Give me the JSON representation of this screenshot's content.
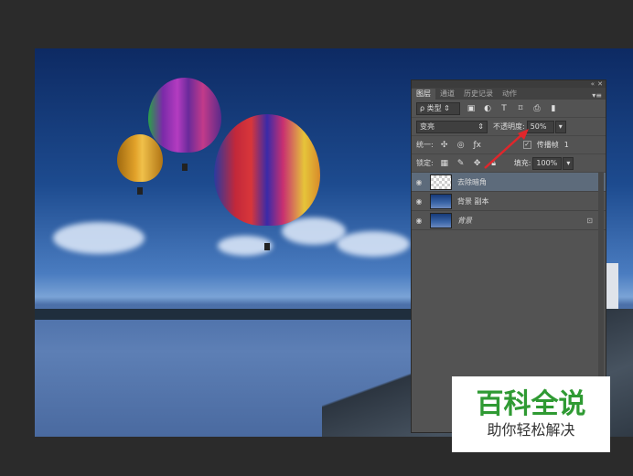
{
  "layers_panel": {
    "tabs": [
      "图层",
      "通道",
      "历史记录",
      "动作"
    ],
    "filter_kind": "类型",
    "blend_mode": "变亮",
    "opacity_label": "不透明度:",
    "opacity_value": "50%",
    "unify_label": "统一:",
    "propagate_label": "传播帧",
    "propagate_value": "1",
    "lock_label": "锁定:",
    "fill_label": "填充:",
    "fill_value": "100%",
    "layers": [
      {
        "name": "去除暗角",
        "selected": true,
        "thumb": "transparent"
      },
      {
        "name": "背景 副本",
        "selected": false,
        "thumb": "image"
      },
      {
        "name": "背景",
        "selected": false,
        "thumb": "image",
        "locked": true
      }
    ]
  },
  "watermark": {
    "title": "百科全说",
    "subtitle": "助你轻松解决"
  },
  "colors": {
    "accent_red": "#e0262b",
    "watermark_green": "#2f9a33",
    "panel_bg": "#535353"
  }
}
